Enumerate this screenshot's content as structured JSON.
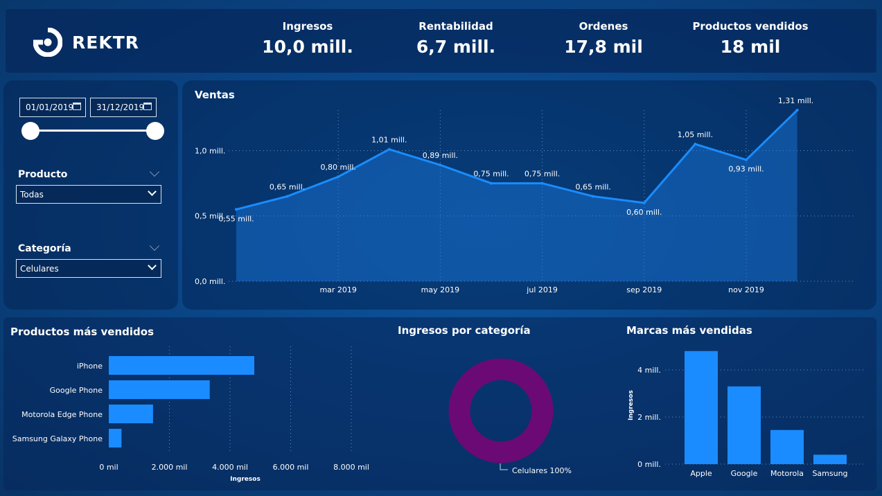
{
  "brand": {
    "name": "REKTR",
    "logo": "rektr-ring-logo"
  },
  "kpis": [
    {
      "label": "Ingresos",
      "value": "10,0 mill."
    },
    {
      "label": "Rentabilidad",
      "value": "6,7 mill."
    },
    {
      "label": "Ordenes",
      "value": "17,8 mil"
    },
    {
      "label": "Productos vendidos",
      "value": "18 mil"
    }
  ],
  "filters": {
    "date_start": "01/01/2019",
    "date_end": "31/12/2019",
    "date_slider_position": {
      "start": 0.0,
      "end": 1.0
    },
    "producto": {
      "label": "Producto",
      "value": "Todas"
    },
    "categoria": {
      "label": "Categoría",
      "value": "Celulares"
    }
  },
  "icons": {
    "calendar": "calendar-icon",
    "chevron": "chevron-down-icon"
  },
  "colors": {
    "accent": "#1a8cff",
    "donut": "#6b0a75",
    "background": "#0a4688"
  },
  "chart_data": [
    {
      "type": "area",
      "title": "Ventas",
      "x": [
        "ene 2019",
        "feb 2019",
        "mar 2019",
        "abr 2019",
        "may 2019",
        "jun 2019",
        "jul 2019",
        "ago 2019",
        "sep 2019",
        "oct 2019",
        "nov 2019",
        "dic 2019"
      ],
      "values": [
        0.55,
        0.65,
        0.8,
        1.01,
        0.89,
        0.75,
        0.75,
        0.65,
        0.6,
        1.05,
        0.93,
        1.31
      ],
      "data_labels": [
        "0,55 mill.",
        "0,65 mill.",
        "0,80 mill.",
        "1,01 mill.",
        "0,89 mill.",
        "0,75 mill.",
        "0,75 mill.",
        "0,65 mill.",
        "0,60 mill.",
        "1,05 mill.",
        "0,93 mill.",
        "1,31 mill."
      ],
      "x_tick_labels": [
        "mar 2019",
        "may 2019",
        "jul 2019",
        "sep 2019",
        "nov 2019"
      ],
      "y_ticks": [
        0,
        0.5,
        1.0
      ],
      "y_tick_labels": [
        "0,0 mill.",
        "0,5 mill.",
        "1,0 mill."
      ],
      "ylim": [
        0,
        1.31
      ],
      "grid": true
    },
    {
      "type": "bar",
      "orientation": "horizontal",
      "title": "Productos más vendidos",
      "categories": [
        "iPhone",
        "Google Phone",
        "Motorola Edge Phone",
        "Samsung Galaxy Phone"
      ],
      "values": [
        4800,
        3330,
        1460,
        420
      ],
      "xlabel": "Ingresos",
      "x_ticks": [
        0,
        2000,
        4000,
        6000,
        8000
      ],
      "x_tick_labels": [
        "0 mil",
        "2.000 mil",
        "4.000 mil",
        "6.000 mil",
        "8.000 mil"
      ],
      "xlim": [
        0,
        8000
      ],
      "grid": true
    },
    {
      "type": "pie",
      "variant": "donut",
      "title": "Ingresos por categoría",
      "categories": [
        "Celulares"
      ],
      "values": [
        100
      ],
      "data_labels": [
        "Celulares 100%"
      ]
    },
    {
      "type": "bar",
      "title": "Marcas más vendidas",
      "categories": [
        "Apple",
        "Google",
        "Motorola",
        "Samsung"
      ],
      "values": [
        4.8,
        3.3,
        1.45,
        0.4
      ],
      "ylabel": "Ingresos",
      "y_ticks": [
        0,
        2,
        4
      ],
      "y_tick_labels": [
        "0 mill.",
        "2 mill.",
        "4 mill."
      ],
      "ylim": [
        0,
        5.0
      ],
      "grid": true
    }
  ]
}
